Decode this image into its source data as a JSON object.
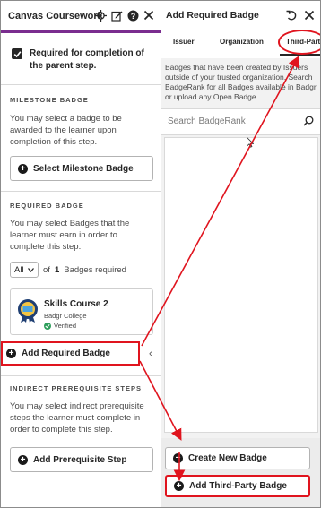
{
  "left_panel": {
    "title": "Canvas Coursework",
    "icons": [
      "move-icon",
      "edit-icon",
      "help-icon",
      "close-icon"
    ],
    "required_completion_label": "Required for completion of the parent step.",
    "milestone": {
      "heading": "MILESTONE BADGE",
      "description": "You may select a badge to be awarded to the learner upon completion of this step.",
      "button_label": "Select Milestone Badge"
    },
    "required": {
      "heading": "REQUIRED BADGE",
      "description": "You may select Badges that the learner must earn in order to complete this step.",
      "select_value": "All",
      "count_prefix": "of",
      "count_value": "1",
      "count_suffix": "Badges required",
      "badge": {
        "name": "Skills Course 2",
        "issuer": "Badgr College",
        "status": "Verified"
      },
      "add_button_label": "Add Required Badge"
    },
    "indirect": {
      "heading": "INDIRECT PREREQUISITE STEPS",
      "description": "You may select indirect prerequisite steps the learner must complete in order to complete this step.",
      "button_label": "Add Prerequisite Step"
    }
  },
  "right_panel": {
    "title": "Add Required Badge",
    "icons": [
      "undo-icon",
      "close-icon"
    ],
    "tabs": [
      {
        "label": "Issuer",
        "active": false
      },
      {
        "label": "Organization",
        "active": false
      },
      {
        "label": "Third-Party",
        "active": true
      }
    ],
    "description": "Badges that have been created by Issuers outside of your trusted organization. Search BadgeRank for all Badges available in Badgr, or upload any Open Badge.",
    "search_placeholder": "Search BadgeRank",
    "buttons": {
      "create_label": "Create New Badge",
      "add_third_party_label": "Add Third-Party Badge"
    }
  },
  "colors": {
    "accent_purple": "#7a2d8f",
    "annotation_red": "#e0141e",
    "verified_green": "#2e9e5b"
  }
}
